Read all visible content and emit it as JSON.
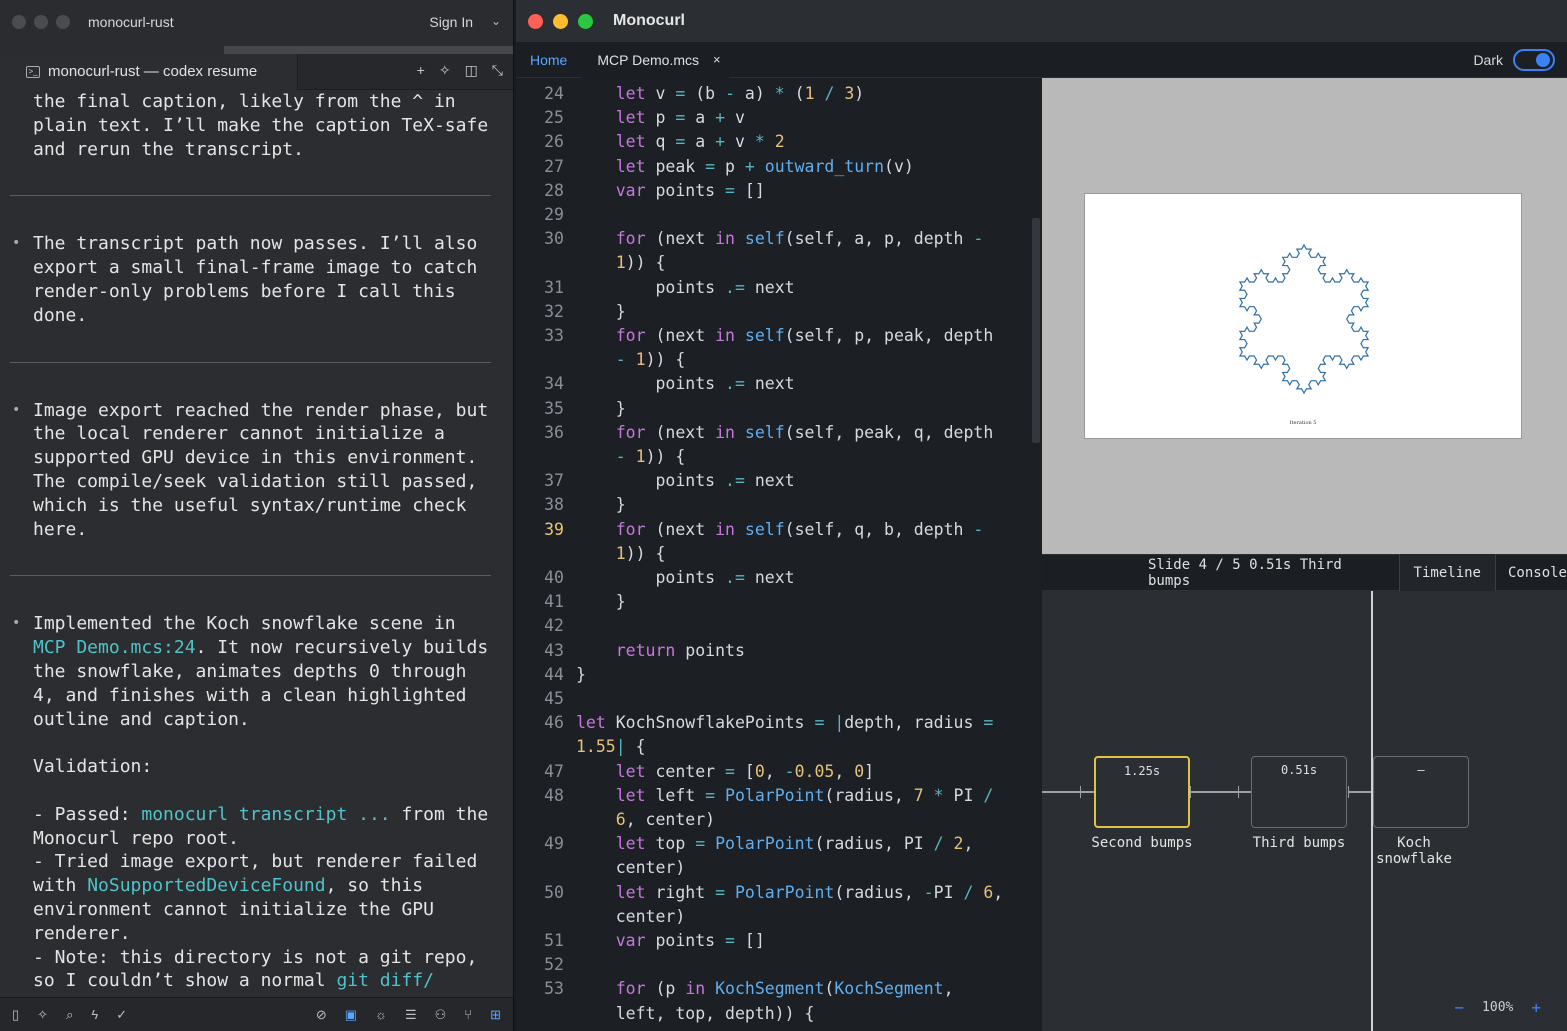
{
  "left_window": {
    "title": "monocurl-rust",
    "sign_in": "Sign In",
    "tab_label": "monocurl-rust — codex resume",
    "tools": [
      "+",
      "✧",
      "◫",
      "⤡"
    ],
    "p0": "the final caption, likely from the ^ in\nplain text. I’ll make the caption TeX-safe\nand rerun the transcript.",
    "p1": "The transcript path now passes. I’ll also\nexport a small final-frame image to catch\nrender-only problems before I call this\ndone.",
    "p2": "Image export reached the render phase, but\nthe local renderer cannot initialize a\nsupported GPU device in this environment.\nThe compile/seek validation still passed,\nwhich is the useful syntax/runtime check\nhere.",
    "p3a": "Implemented the Koch snowflake scene in\n",
    "p3link": "MCP Demo.mcs:24",
    "p3b": ". It now recursively builds\nthe snowflake, animates depths 0 through\n4, and finishes with a clean highlighted\noutline and caption.\n\nValidation:\n\n- Passed: ",
    "p3cmd": "monocurl transcript ...",
    "p3c": " from the\nMonocurl repo root.\n- Tried image export, but renderer failed\nwith ",
    "p3err": "NoSupportedDeviceFound",
    "p3d": ", so this\nenvironment cannot initialize the GPU\nrenderer.\n- Note: this directory is not a git repo,\nso I couldn’t show a normal ",
    "p3git": "git diff/"
  },
  "right_window": {
    "title": "Monocurl",
    "tab_home": "Home",
    "tab_file": "MCP Demo.mcs",
    "tab_close": "×",
    "theme_label": "Dark",
    "theme_on": true,
    "caption": "Iteration 5",
    "status_slide": "Slide 4 / 5 0.51s Third bumps",
    "btn_timeline": "Timeline",
    "btn_console": "Console",
    "zoom_minus": "−",
    "zoom_level": "100%",
    "zoom_plus": "+",
    "slides": [
      {
        "time": "1.25s",
        "label": "Second bumps",
        "active": true
      },
      {
        "time": "0.51s",
        "label": "Third bumps",
        "active": false
      },
      {
        "time": "–",
        "label": "Koch snowflake",
        "active": false
      }
    ]
  },
  "editor": {
    "current_line": 39,
    "lines": [
      {
        "n": "24",
        "t": "    let v = (b - a) * (1 / 3)"
      },
      {
        "n": "25",
        "t": "    let p = a + v"
      },
      {
        "n": "26",
        "t": "    let q = a + v * 2"
      },
      {
        "n": "27",
        "t": "    let peak = p + outward_turn(v)"
      },
      {
        "n": "28",
        "t": "    var points = []"
      },
      {
        "n": "29",
        "t": ""
      },
      {
        "n": "30",
        "t": "    for (next in self(self, a, p, depth -"
      },
      {
        "n": "",
        "t": "    1)) {"
      },
      {
        "n": "31",
        "t": "        points .= next"
      },
      {
        "n": "32",
        "t": "    }"
      },
      {
        "n": "33",
        "t": "    for (next in self(self, p, peak, depth"
      },
      {
        "n": "",
        "t": "    - 1)) {"
      },
      {
        "n": "34",
        "t": "        points .= next"
      },
      {
        "n": "35",
        "t": "    }"
      },
      {
        "n": "36",
        "t": "    for (next in self(self, peak, q, depth"
      },
      {
        "n": "",
        "t": "    - 1)) {"
      },
      {
        "n": "37",
        "t": "        points .= next"
      },
      {
        "n": "38",
        "t": "    }"
      },
      {
        "n": "39",
        "t": "    for (next in self(self, q, b, depth -"
      },
      {
        "n": "",
        "t": "    1)) {"
      },
      {
        "n": "40",
        "t": "        points .= next"
      },
      {
        "n": "41",
        "t": "    }"
      },
      {
        "n": "42",
        "t": ""
      },
      {
        "n": "43",
        "t": "    return points"
      },
      {
        "n": "44",
        "t": "}"
      },
      {
        "n": "45",
        "t": ""
      },
      {
        "n": "46",
        "t": "let KochSnowflakePoints = |depth, radius ="
      },
      {
        "n": "",
        "t": "1.55| {"
      },
      {
        "n": "47",
        "t": "    let center = [0, -0.05, 0]"
      },
      {
        "n": "48",
        "t": "    let left = PolarPoint(radius, 7 * PI /"
      },
      {
        "n": "",
        "t": "    6, center)"
      },
      {
        "n": "49",
        "t": "    let top = PolarPoint(radius, PI / 2,"
      },
      {
        "n": "",
        "t": "    center)"
      },
      {
        "n": "50",
        "t": "    let right = PolarPoint(radius, -PI / 6,"
      },
      {
        "n": "",
        "t": "    center)"
      },
      {
        "n": "51",
        "t": "    var points = []"
      },
      {
        "n": "52",
        "t": ""
      },
      {
        "n": "53",
        "t": "    for (p in KochSegment(KochSegment,"
      },
      {
        "n": "",
        "t": "    left, top, depth)) {"
      }
    ]
  },
  "colors": {
    "keyword": "#c678dd",
    "function": "#61afef",
    "number": "#e5c07b",
    "operator": "#56b6c2",
    "accent_blue": "#3b82f6",
    "active_slide": "#e0c341",
    "snowflake": "#2f6ea8"
  },
  "icons": {
    "left_bottom_left": [
      "sidebar-icon",
      "sparkle-icon",
      "search-icon",
      "bolt-icon",
      "check-icon"
    ],
    "left_bottom_right": [
      "eye-off-icon",
      "terminal-icon",
      "bug-icon",
      "list-icon",
      "people-icon",
      "branch-icon",
      "tree-icon"
    ]
  }
}
